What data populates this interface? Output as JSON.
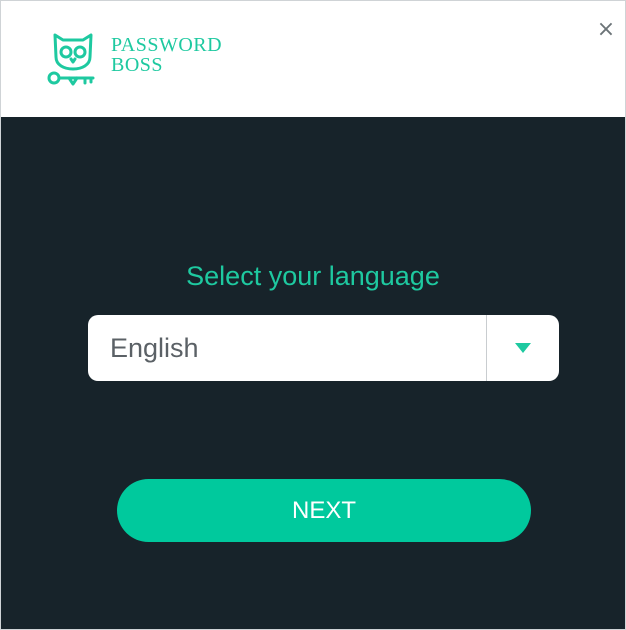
{
  "window": {
    "close_glyph": "×"
  },
  "header": {
    "brand_line1": "PASSWORD",
    "brand_line2": "BOSS",
    "logo_icon": "owl-key-icon"
  },
  "main": {
    "prompt": "Select your language",
    "language_select": {
      "selected": "English",
      "arrow_icon": "chevron-down-icon"
    },
    "next_label": "NEXT"
  },
  "colors": {
    "accent": "#1ec9a0",
    "button": "#00c99d",
    "background": "#17232a",
    "header_bg": "#ffffff"
  }
}
